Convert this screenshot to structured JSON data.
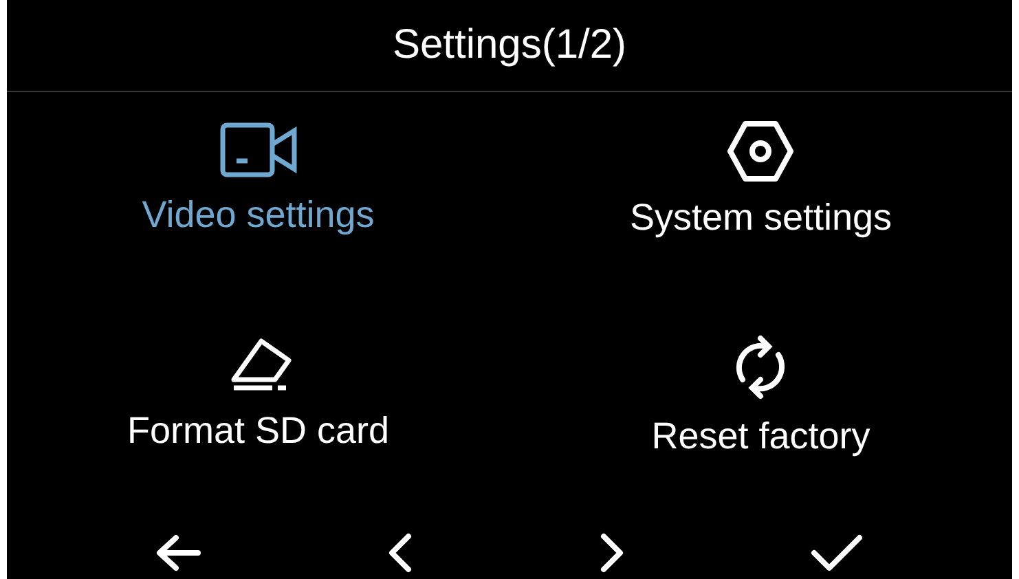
{
  "header": {
    "title": "Settings(1/2)"
  },
  "menu_items": [
    {
      "kind": "video",
      "label": "Video settings",
      "selected": true
    },
    {
      "kind": "system",
      "label": "System settings",
      "selected": false
    },
    {
      "kind": "format",
      "label": "Format SD card",
      "selected": false
    },
    {
      "kind": "reset",
      "label": "Reset factory",
      "selected": false
    }
  ],
  "nav_buttons": [
    {
      "kind": "back"
    },
    {
      "kind": "previous"
    },
    {
      "kind": "next"
    },
    {
      "kind": "confirm"
    }
  ]
}
